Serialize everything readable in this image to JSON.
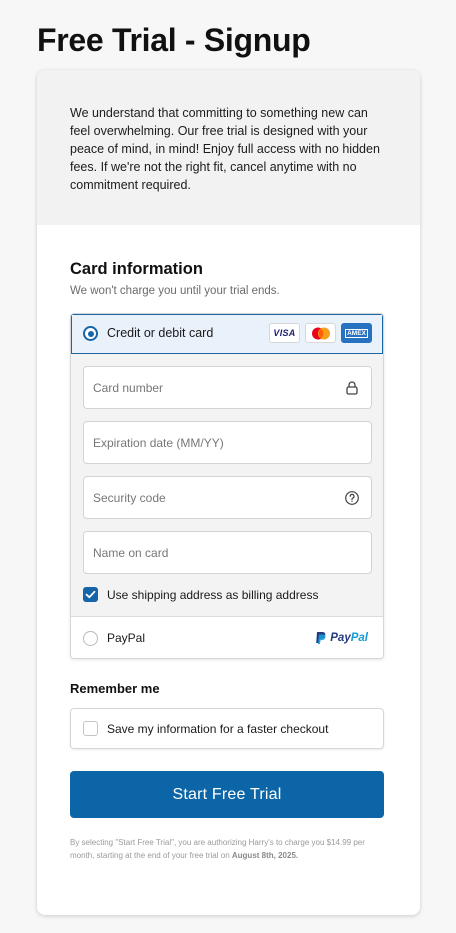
{
  "page": {
    "title": "Free Trial - Signup"
  },
  "intro": {
    "text": "We understand that committing to something new can feel overwhelming. Our free trial is designed with your peace of mind, in mind! Enjoy full access with no hidden fees. If we're not the right fit, cancel anytime with no commitment required."
  },
  "card_info": {
    "title": "Card information",
    "subtitle": "We won't charge you until your trial ends."
  },
  "payment": {
    "card_option_label": "Credit or debit card",
    "card_option_selected": true,
    "brands": {
      "visa": "VISA",
      "mastercard": "mastercard-icon",
      "amex": "AMEX"
    },
    "fields": {
      "card_number": {
        "placeholder": "Card number",
        "value": "",
        "icon": "lock-icon"
      },
      "expiration": {
        "placeholder": "Expiration date (MM/YY)",
        "value": ""
      },
      "security_code": {
        "placeholder": "Security code",
        "value": "",
        "icon": "help-circle-icon"
      },
      "name_on_card": {
        "placeholder": "Name on card",
        "value": ""
      }
    },
    "billing_checkbox": {
      "label": "Use shipping address as billing address",
      "checked": true
    },
    "paypal_option_label": "PayPal",
    "paypal_option_selected": false,
    "paypal_logo": {
      "part1": "Pay",
      "part2": "Pal"
    }
  },
  "remember": {
    "title": "Remember me",
    "checkbox_label": "Save my information for a faster checkout",
    "checked": false
  },
  "cta": {
    "label": "Start Free Trial"
  },
  "legal": {
    "text_before": "By selecting \"Start Free Trial\", you are authorizing Harry's to charge you $14.99 per month, starting at the end of your free trial on ",
    "date": "August 8th, 2025."
  },
  "colors": {
    "accent": "#0b65a6",
    "selected_bg": "#e9f1fb",
    "intro_bg": "#f2f2f2"
  }
}
